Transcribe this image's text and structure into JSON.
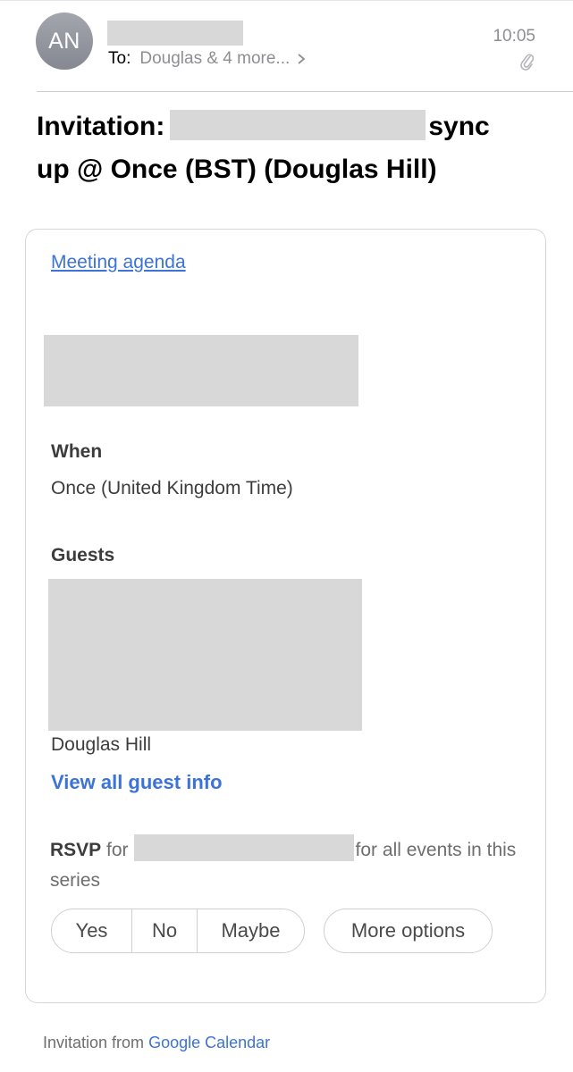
{
  "header": {
    "avatar_initials": "AN",
    "to_label": "To:",
    "recipients": "Douglas & 4 more...",
    "time": "10:05"
  },
  "subject": {
    "prefix": "Invitation:",
    "suffix": "sync",
    "line2": "up @ Once (BST) (Douglas Hill)"
  },
  "card": {
    "agenda_link": "Meeting agenda",
    "when_label": "When",
    "when_value": "Once (United Kingdom Time)",
    "guests_label": "Guests",
    "guest_name": "Douglas Hill",
    "view_guests_link": "View all guest info",
    "rsvp_label": "RSVP",
    "rsvp_for": "for",
    "rsvp_series": "for all events in this series",
    "buttons": {
      "yes": "Yes",
      "no": "No",
      "maybe": "Maybe",
      "more": "More options"
    }
  },
  "footer": {
    "prefix": "Invitation from",
    "link": "Google Calendar"
  },
  "colors": {
    "link": "#3b73d8",
    "muted": "#8e8e93",
    "redaction": "#d8d8d8"
  }
}
